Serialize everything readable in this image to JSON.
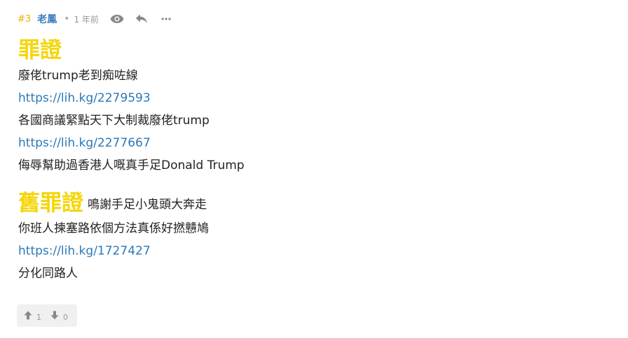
{
  "post": {
    "floor": "#3",
    "username": "老鳳",
    "separator": "•",
    "time": "1 年前",
    "icons": {
      "view": "eye-icon",
      "reply": "reply-icon",
      "more": "more-icon"
    },
    "heading1": "罪證",
    "lines": [
      "廢佬trump老到痴咗線",
      "https://lih.kg/2279593",
      "各國商議緊點天下大制裁廢佬trump",
      "https://lih.kg/2277667",
      "侮辱幫助過香港人嘅真手足Donald Trump"
    ],
    "heading2": "舊罪證",
    "heading2_tail": "鳴謝手足小鬼頭大奔走",
    "lines2": [
      "你班人揀塞路依個方法真係好撚戇鳩",
      "https://lih.kg/1727427",
      "分化同路人"
    ],
    "votes": {
      "up_count": "1",
      "down_count": "0"
    }
  },
  "colors": {
    "floor": "#e8b400",
    "username": "#3b7dbf",
    "highlight": "#f5d60a",
    "link": "#2a79b8",
    "muted": "#999999",
    "vote_bg": "#f0f0f0"
  }
}
